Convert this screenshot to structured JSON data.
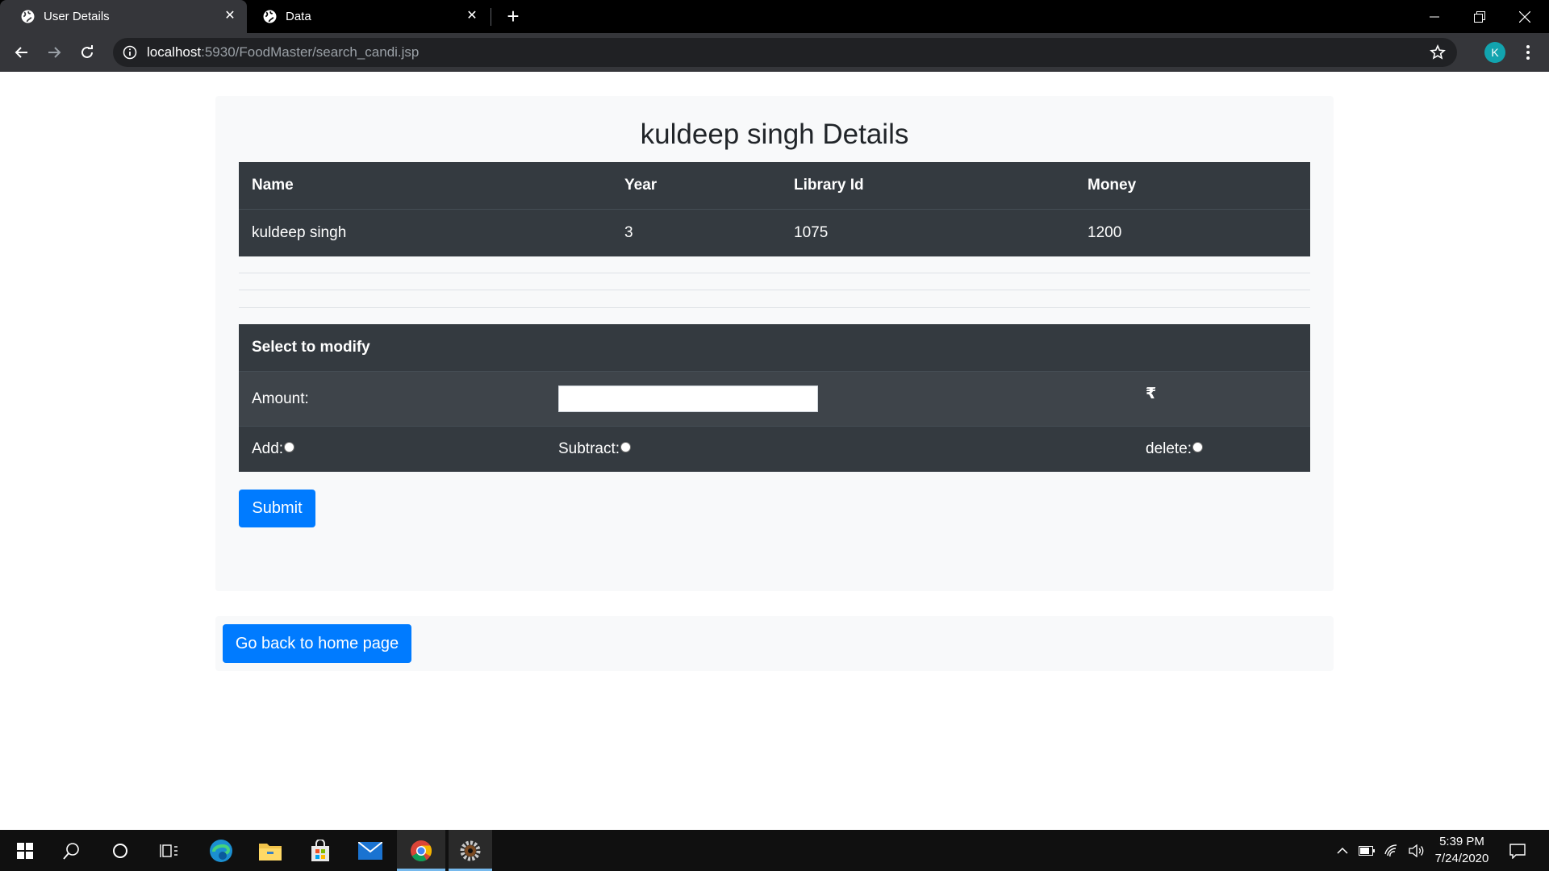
{
  "browser": {
    "tabs": [
      {
        "title": "User Details",
        "active": true
      },
      {
        "title": "Data",
        "active": false
      }
    ],
    "url_host": "localhost",
    "url_path": ":5930/FoodMaster/search_candi.jsp",
    "profile_initial": "K"
  },
  "page": {
    "title": "kuldeep singh Details",
    "details_table": {
      "headers": [
        "Name",
        "Year",
        "Library Id",
        "Money"
      ],
      "row": [
        "kuldeep singh",
        "3",
        "1075",
        "1200"
      ]
    },
    "modify": {
      "heading": "Select to modify",
      "amount_label": "Amount:",
      "amount_value": "",
      "currency_symbol": "₹",
      "options": [
        "Add:",
        "Subtract:",
        "delete:"
      ],
      "submit_label": "Submit"
    },
    "home_button_label": "Go back to home page"
  },
  "taskbar": {
    "time": "5:39 PM",
    "date": "7/24/2020"
  },
  "colors": {
    "primary": "#007bff",
    "table_dark": "#343a40",
    "panel_bg": "#f8f9fa"
  }
}
